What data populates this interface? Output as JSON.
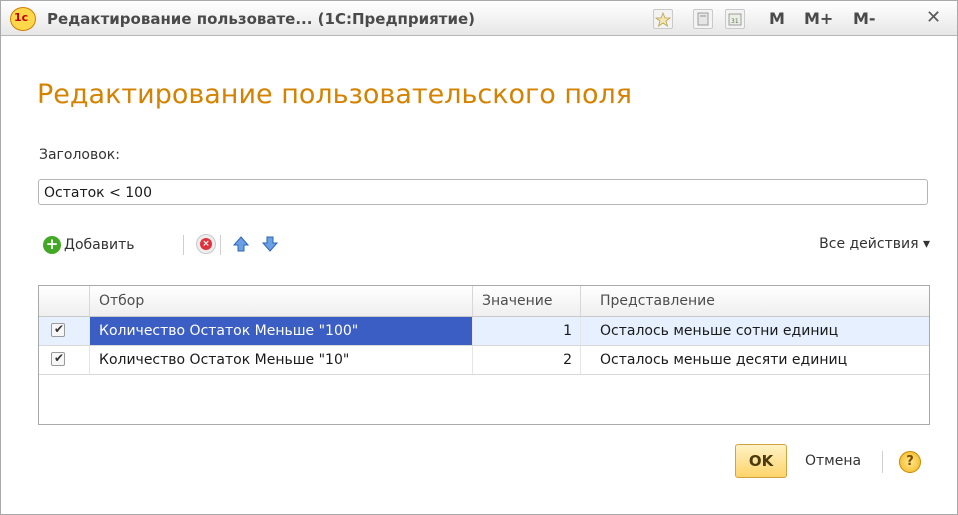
{
  "window": {
    "title": "Редактирование пользовате...  (1С:Предприятие)",
    "logo_text": "1с",
    "title_buttons": {
      "m": "M",
      "m_plus": "M+",
      "m_minus": "M-",
      "close": "✕"
    }
  },
  "form": {
    "heading": "Редактирование пользовательского поля",
    "header_label": "Заголовок:",
    "header_value": "Остаток < 100"
  },
  "toolbar": {
    "add_label": "Добавить",
    "all_actions_label": "Все действия ▾"
  },
  "table": {
    "columns": [
      "Отбор",
      "Значение",
      "Представление"
    ],
    "rows": [
      {
        "checked": true,
        "otbor": "Количество Остаток Меньше \"100\"",
        "znachenie": "1",
        "predstavlenie": "Осталось меньше сотни единиц",
        "selected": true
      },
      {
        "checked": true,
        "otbor": "Количество Остаток Меньше \"10\"",
        "znachenie": "2",
        "predstavlenie": "Осталось меньше десяти единиц",
        "selected": false
      }
    ]
  },
  "footer": {
    "ok_label": "OK",
    "cancel_label": "Отмена",
    "help_label": "?"
  },
  "colors": {
    "heading": "#d48300",
    "selection": "#3b5ec5",
    "ok_button": "#ffd46a"
  }
}
